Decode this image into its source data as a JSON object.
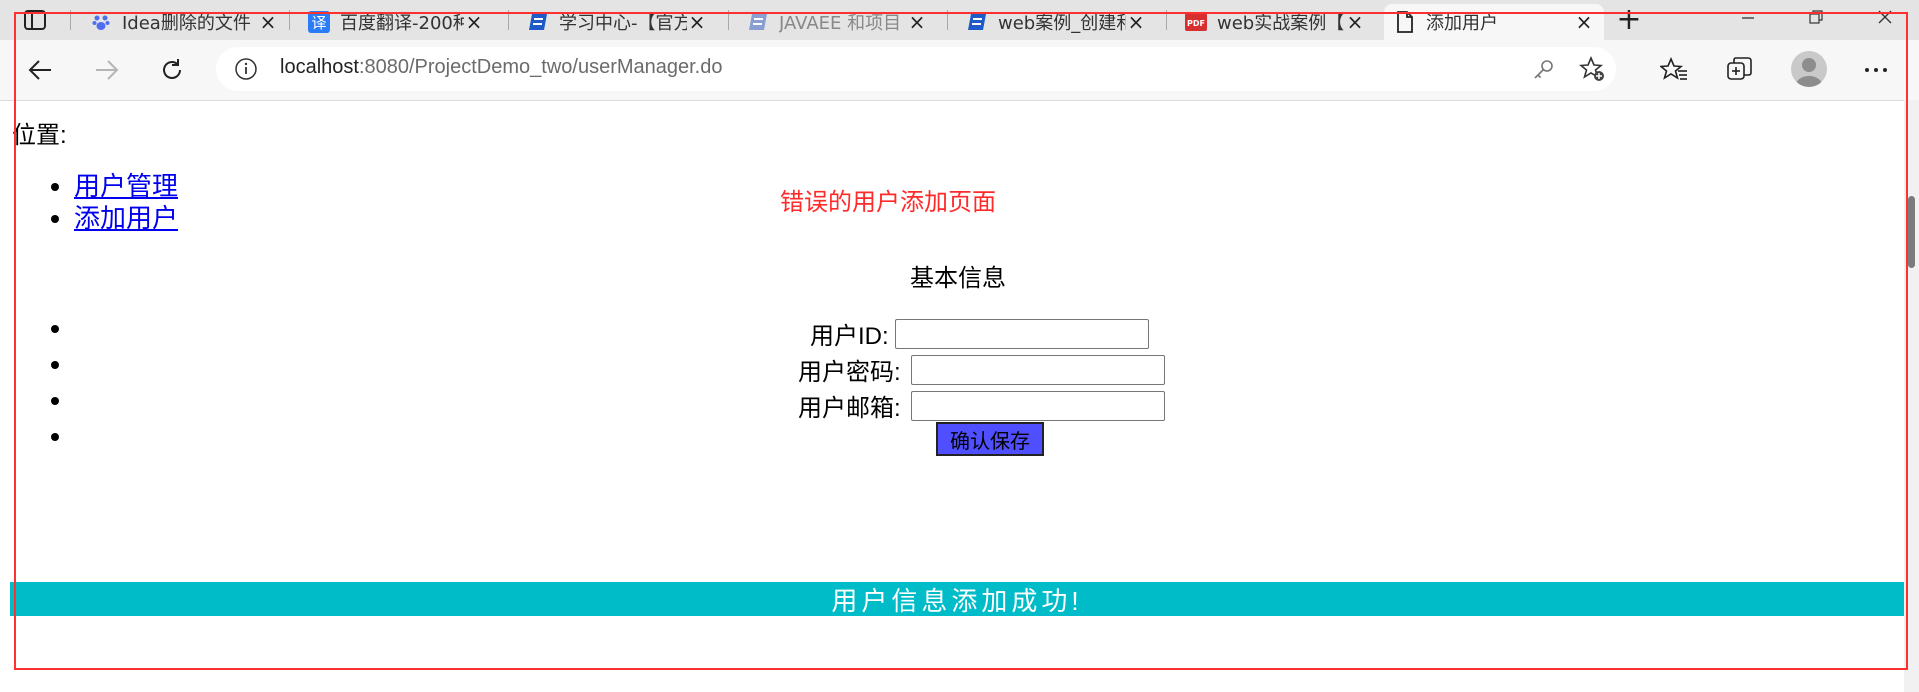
{
  "browser": {
    "tabs": [
      {
        "label": "Idea删除的文件",
        "icon": "baidu-paw-icon",
        "active": false
      },
      {
        "label": "百度翻译-200种",
        "icon": "baidu-translate-icon",
        "active": false
      },
      {
        "label": "学习中心-【官方",
        "icon": "csdn-edu-icon",
        "active": false
      },
      {
        "label": "JAVAEE 和项目",
        "icon": "csdn-edu-icon",
        "active": false
      },
      {
        "label": "web案例_创建和",
        "icon": "csdn-edu-icon",
        "active": false
      },
      {
        "label": "web实战案例【",
        "icon": "pdf-icon",
        "active": false
      },
      {
        "label": "添加用户",
        "icon": "page-icon",
        "active": true
      }
    ],
    "url_host": "localhost",
    "url_rest": ":8080/ProjectDemo_two/userManager.do",
    "colors": {
      "tabbar": "#e4e4e4",
      "toolbar": "#f7f7f7",
      "accent": "#ff3030"
    }
  },
  "page": {
    "location_label": "位置:",
    "nav_links": [
      "用户管理",
      "添加用户"
    ],
    "error_title": "错误的用户添加页面",
    "form_title": "基本信息",
    "fields": [
      {
        "label": "用户ID:",
        "value": ""
      },
      {
        "label": "用户密码:",
        "value": ""
      },
      {
        "label": "用户邮箱:",
        "value": ""
      }
    ],
    "save_label": "确认保存",
    "success_message": "用户信息添加成功!",
    "colors": {
      "error": "#ff2a2a",
      "success_bar": "#00bbc8",
      "save_button": "#4f4fff",
      "link": "#0000ee"
    }
  }
}
